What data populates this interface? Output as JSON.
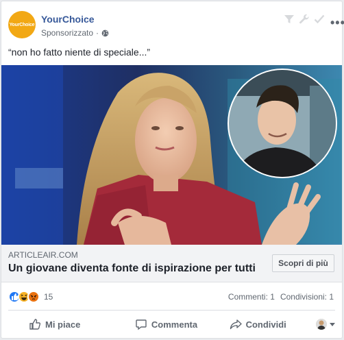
{
  "post": {
    "page_name": "YourChoice",
    "avatar_text": "YourChoice",
    "sponsored_label": "Sponsorizzato",
    "separator": "·",
    "text": "“non ho fatto niente di speciale...”"
  },
  "link": {
    "domain": "ARTICLEAIR.COM",
    "title": "Un giovane diventa fonte di ispirazione per tutti",
    "cta_label": "Scopri di più"
  },
  "stats": {
    "reaction_count": "15",
    "reactions": [
      "like-icon",
      "haha-icon",
      "angry-icon"
    ],
    "comments": "Commenti: 1",
    "shares": "Condivisioni: 1"
  },
  "actions": {
    "like_label": "Mi piace",
    "comment_label": "Commenta",
    "share_label": "Condividi"
  },
  "colors": {
    "brand": "#f2a814",
    "link_blue": "#365899",
    "like_blue": "#2078f4",
    "haha_yellow": "#f7b125",
    "angry_orange": "#e9710f"
  }
}
